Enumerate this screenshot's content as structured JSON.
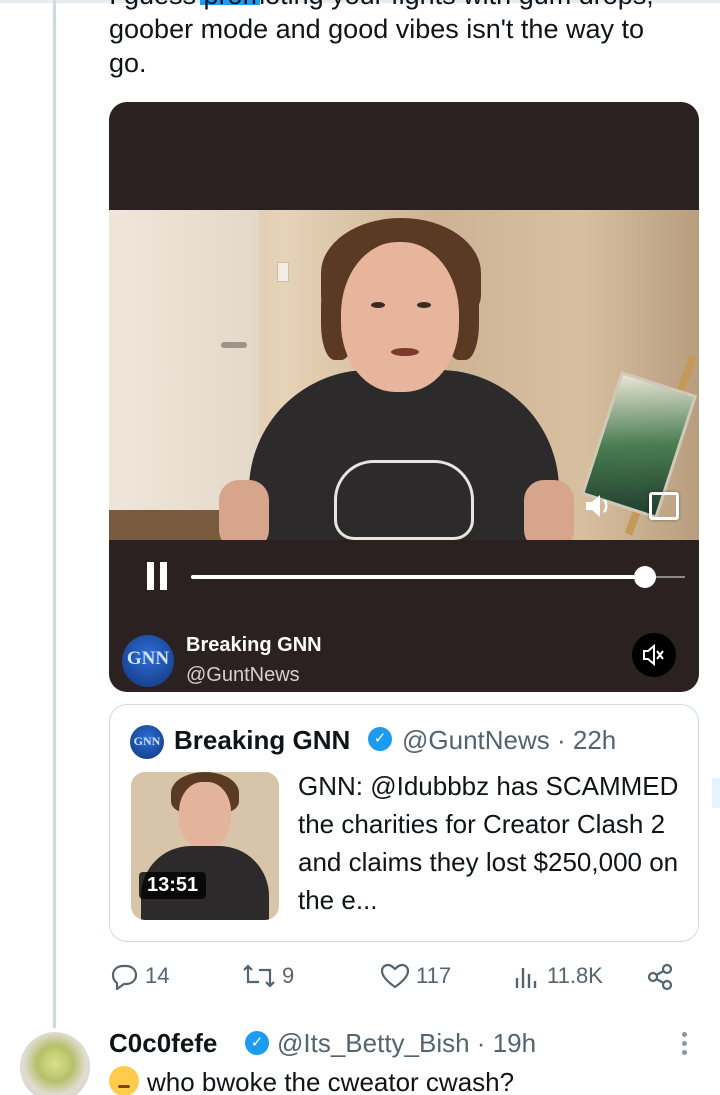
{
  "tweet": {
    "text_clipped_line": "I guess promoting your fights with gum drops,",
    "text_line_2": "goober mode and good vibes isn't the way to",
    "text_line_3": "go."
  },
  "video": {
    "source_avatar_text": "GNN",
    "source_name": "Breaking GNN",
    "source_handle": "@GuntNews",
    "progress": 0.92,
    "muted": true
  },
  "quote": {
    "avatar_text": "GNN",
    "name": "Breaking GNN",
    "meta": "@GuntNews · 22h",
    "duration": "13:51",
    "text": "GNN: @Idubbbz has SCAMMED the charities for Creator Clash 2 and claims they lost $250,000 on the e..."
  },
  "actions": {
    "replies": "14",
    "reposts": "9",
    "likes": "117",
    "views": "11.8K"
  },
  "reply": {
    "name": "C0c0fefe",
    "meta": "@Its_Betty_Bish · 19h",
    "text": "who bwoke the cweator cwash?"
  },
  "colors": {
    "accent": "#1d9bf0",
    "muted_text": "#536471",
    "video_bg": "#2b2121"
  },
  "icons": [
    "pause-icon",
    "volume-icon",
    "expand-icon",
    "mute-icon",
    "verified-icon",
    "reply-icon",
    "repost-icon",
    "like-icon",
    "views-icon",
    "share-icon",
    "more-icon"
  ]
}
